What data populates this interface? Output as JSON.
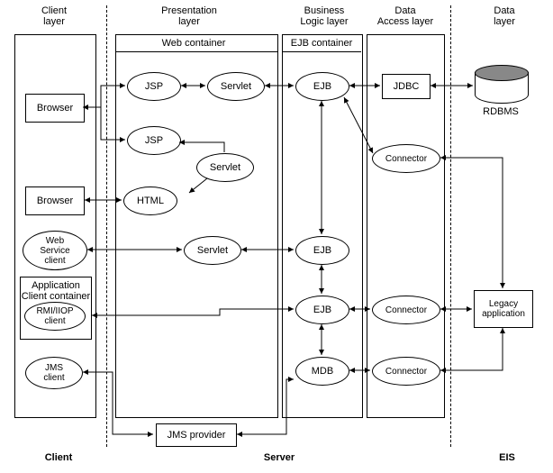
{
  "layers": {
    "client": "Client\nlayer",
    "presentation": "Presentation\nlayer",
    "business": "Business\nLogic layer",
    "dataaccess": "Data\nAccess layer",
    "data": "Data\nlayer"
  },
  "sublabels": {
    "web_container": "Web container",
    "ejb_container": "EJB container",
    "app_client_container": "Application\nClient container"
  },
  "nodes": {
    "browser1": "Browser",
    "browser2": "Browser",
    "web_service_client": "Web\nService\nclient",
    "rmi_client": "RMI/IIOP\nclient",
    "jms_client": "JMS\nclient",
    "jsp1": "JSP",
    "jsp2": "JSP",
    "servlet1": "Servlet",
    "servlet2": "Servlet",
    "html": "HTML",
    "servlet3": "Servlet",
    "ejb1": "EJB",
    "ejb2": "EJB",
    "ejb3": "EJB",
    "mdb": "MDB",
    "jdbc": "JDBC",
    "connector1": "Connector",
    "connector2": "Connector",
    "connector3": "Connector",
    "rdbms": "RDBMS",
    "legacy": "Legacy\napplication",
    "jms_provider": "JMS provider"
  },
  "footer": {
    "client": "Client",
    "server": "Server",
    "eis": "EIS"
  }
}
